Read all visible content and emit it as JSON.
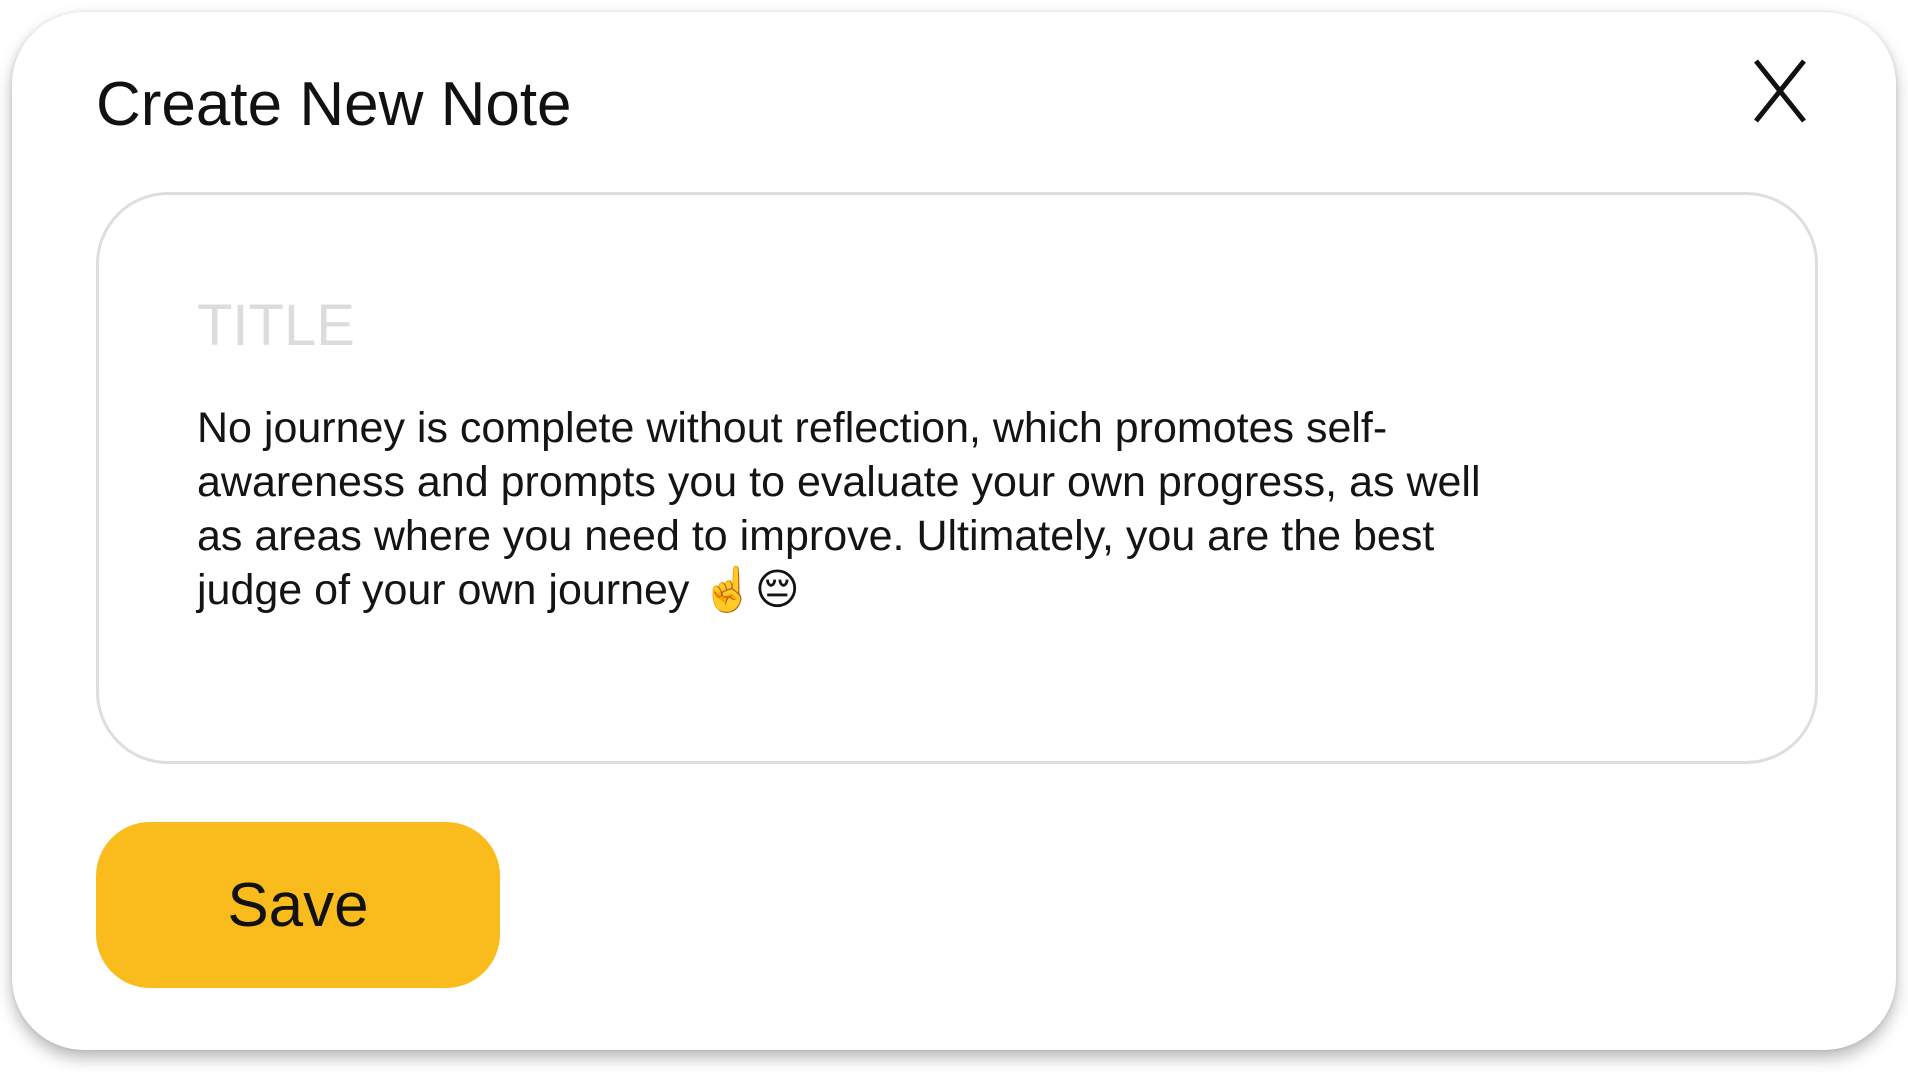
{
  "modal": {
    "title": "Create New Note",
    "close_label": "X"
  },
  "note": {
    "title_placeholder": "TITLE",
    "title_value": "",
    "body_text": "No journey is complete without reflection, which promotes self-\nawareness and prompts you to evaluate your own progress, as well\nas areas where you need to improve. Ultimately, you are the best\njudge of your own journey ☝️😔"
  },
  "actions": {
    "save_label": "Save"
  },
  "colors": {
    "accent": "#f9bc1c",
    "border": "#dedede",
    "placeholder": "#dcdcdc",
    "text": "#141414"
  },
  "icons": {
    "close": "close-icon"
  }
}
